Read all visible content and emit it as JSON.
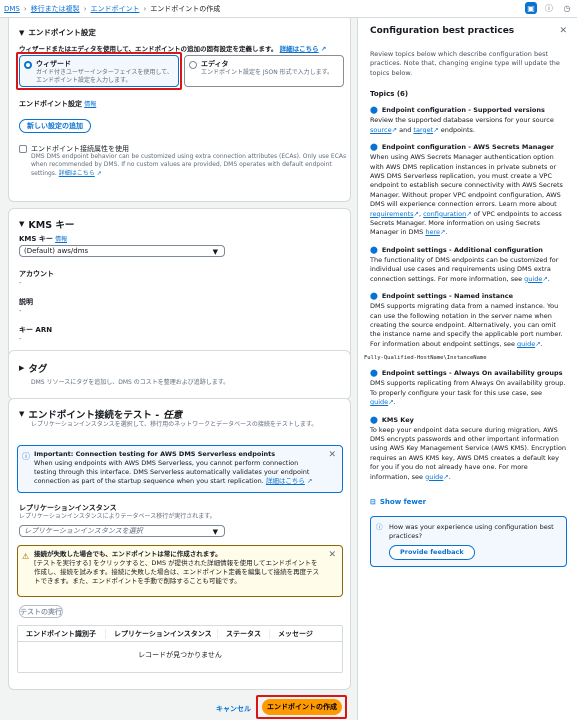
{
  "breadcrumb": [
    "DMS",
    "移行または複製",
    "エンドポイント",
    "エンドポイントの作成"
  ],
  "header_icons": [
    "panel-icon",
    "info-icon",
    "clock-icon"
  ],
  "endpoint_settings": {
    "title": "エンドポイント設定",
    "intro": "ウィザードまたはエディタを使用して、エンドポイントの追加の固有設定を定義します。",
    "intro_link": "詳細はこちら",
    "wizard_label": "ウィザード",
    "wizard_desc": "ガイド付きユーザーインターフェイスを使用して、エンドポイント設定を入力します。",
    "editor_label": "エディタ",
    "editor_desc": "エンドポイント設定を JSON 形式で入力します。",
    "settings_label": "エンドポイント設定",
    "info": "情報",
    "new_setting_button": "新しい設定の追加",
    "eca_label": "エンドポイント接続属性を使用",
    "eca_desc": "DMS DMS endpoint behavior can be customized using extra connection attributes (ECAs). Only use ECAs when recommended by DMS. If no custom values are provided, DMS operates with default endpoint settings.",
    "eca_link": "詳細はこちら"
  },
  "kms": {
    "title": "KMS キー",
    "key_label": "KMS キー",
    "info": "情報",
    "key_value": "(Default) aws/dms",
    "account_label": "アカウント",
    "account_value": "-",
    "desc_label": "説明",
    "desc_value": "-",
    "arn_label": "キー ARN",
    "arn_value": "-"
  },
  "tags": {
    "title": "タグ",
    "desc": "DMS リソースにタグを追加し、DMS のコストを整理および追跡します。"
  },
  "test": {
    "title": "エンドポイント接続をテスト - ",
    "title_optional": "任意",
    "desc": "レプリケーションインスタンスを選択して、移行用のネットワークとデータベースの接続をテストします。",
    "info_title": "Important: Connection testing for AWS DMS Serverless endpoints",
    "info_body": "When using endpoints with AWS DMS Serverless, you cannot perform connection testing through this interface. DMS Serverless automatically validates your endpoint connection as part of the startup sequence when you start replication.",
    "info_link": "詳細はこちら",
    "instance_label": "レプリケーションインスタンス",
    "instance_desc": "レプリケーションインスタンスによりテータベース移行が実行されます。",
    "instance_placeholder": "レプリケーションインスタンスを選択",
    "warn_title": "接続が失敗した場合でも、エンドポイントは常に作成されます。",
    "warn_body": "[テストを実行する] をクリックすると、DMS が提供された詳細情報を使用してエンドポイントを作成し、接続を試みます。接続に失敗した場合は、エンドポイント定義を編集して接続を再度テストできます。また、エンドポイントを手動で削除することも可能です。",
    "run_button": "テストの実行",
    "columns": [
      "エンドポイント識別子",
      "レプリケーションインスタンス",
      "ステータス",
      "メッセージ"
    ],
    "empty": "レコードが見つかりません"
  },
  "footer": {
    "cancel": "キャンセル",
    "create": "エンドポイントの作成"
  },
  "panel": {
    "title": "Configuration best practices",
    "intro": "Review topics below which describe configuration best practices. Note that, changing engine type will update the topics below.",
    "topics_heading": "Topics (6)",
    "topics": [
      {
        "title": "Endpoint configuration - Supported versions",
        "body": "Review the supported database versions for your source ",
        "link1": "source",
        "mid": " and ",
        "link2": "target",
        "tail": " endpoints."
      },
      {
        "title": "Endpoint configuration - AWS Secrets Manager",
        "body": "When using AWS Secrets Manager authentication option with AWS DMS replication instances in private subnets or AWS DMS Serverless replication, you must create a VPC endpoint to establish secure connectivity with AWS Secrets Manager. Without proper VPC endpoint configuration, AWS DMS will experience connection errors. Learn more about ",
        "link1": "requirements",
        "mid": ", ",
        "link2": "configuration",
        "tail": " of VPC endpoints to access Secrets Manager. More information on using Secrets Manager in DMS ",
        "link3": "here",
        "tail2": "."
      },
      {
        "title": "Endpoint settings - Additional configuration",
        "body": "The functionality of DMS endpoints can be customized for individual use cases and requirements using DMS extra connection settings. For more information, see ",
        "link1": "guide",
        "tail": "."
      },
      {
        "title": "Endpoint settings - Named instance",
        "body": "DMS supports migrating data from a named instance. You can use the following notation in the server name when creating the source endpoint. Alternatively, you can omit the instance name and specify the applicable port number. For information about endpoint settings, see ",
        "link1": "guide",
        "tail": ".",
        "code": "Fully-Qualified-HostName\\InstanceName"
      },
      {
        "title": "Endpoint settings - Always On availability groups",
        "body": "DMS supports replicating from Always On availability group. To properly configure your task for this use case, see ",
        "link1": "guide",
        "tail": "."
      },
      {
        "title": "KMS Key",
        "body": "To keep your endpoint data secure during migration, AWS DMS encrypts passwords and other important information using AWS Key Management Service (AWS KMS). Encryption requires an AWS KMS key, AWS DMS creates a default key for you if you do not already have one. For more information, see ",
        "link1": "guide",
        "tail": "."
      }
    ],
    "show_fewer": "Show fewer",
    "feedback_q": "How was your experience using configuration best practices?",
    "feedback_button": "Provide feedback"
  }
}
